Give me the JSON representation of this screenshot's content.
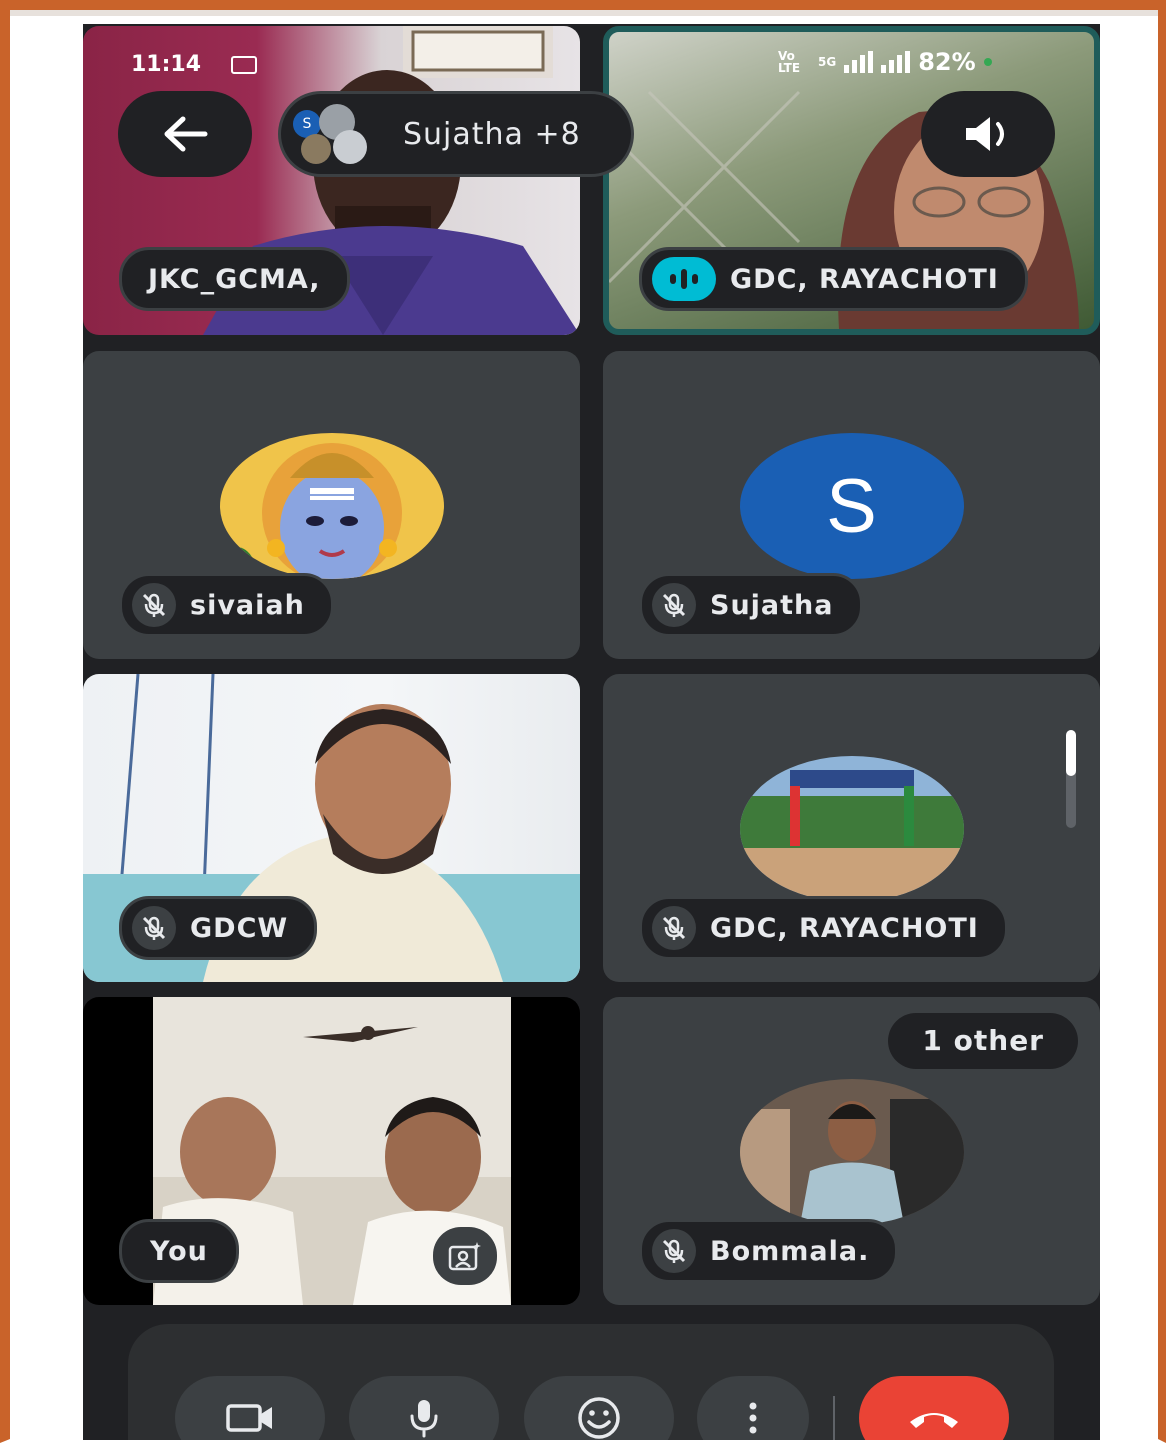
{
  "status_bar": {
    "time": "11:14",
    "network": "Vo LTE",
    "network_type": "5G",
    "battery": "82%"
  },
  "top_bar": {
    "meeting_label": "Sujatha +8"
  },
  "tiles": [
    {
      "name": "JKC_GCMA,",
      "muted": false
    },
    {
      "name": "GDC, RAYACHOTI",
      "muted": false,
      "speaking": true
    },
    {
      "name": "sivaiah",
      "muted": true
    },
    {
      "name": "Sujatha",
      "muted": true,
      "initial": "S"
    },
    {
      "name": "GDCW",
      "muted": true
    },
    {
      "name": "GDC, RAYACHOTI",
      "muted": true
    },
    {
      "name": "You",
      "muted": false
    },
    {
      "name": "Bommala.",
      "muted": true,
      "badge": "1 other"
    }
  ],
  "controls": [
    "camera-icon",
    "microphone-icon",
    "emoji-icon",
    "more-options-icon",
    "end-call-icon"
  ],
  "colors": {
    "background": "#202124",
    "tile": "#3c4043",
    "speaking_ring": "#1f5c5a",
    "speaking_dot": "#00bcd4",
    "avatar_blue": "#1a5fb4",
    "end_call": "#ea4335"
  }
}
